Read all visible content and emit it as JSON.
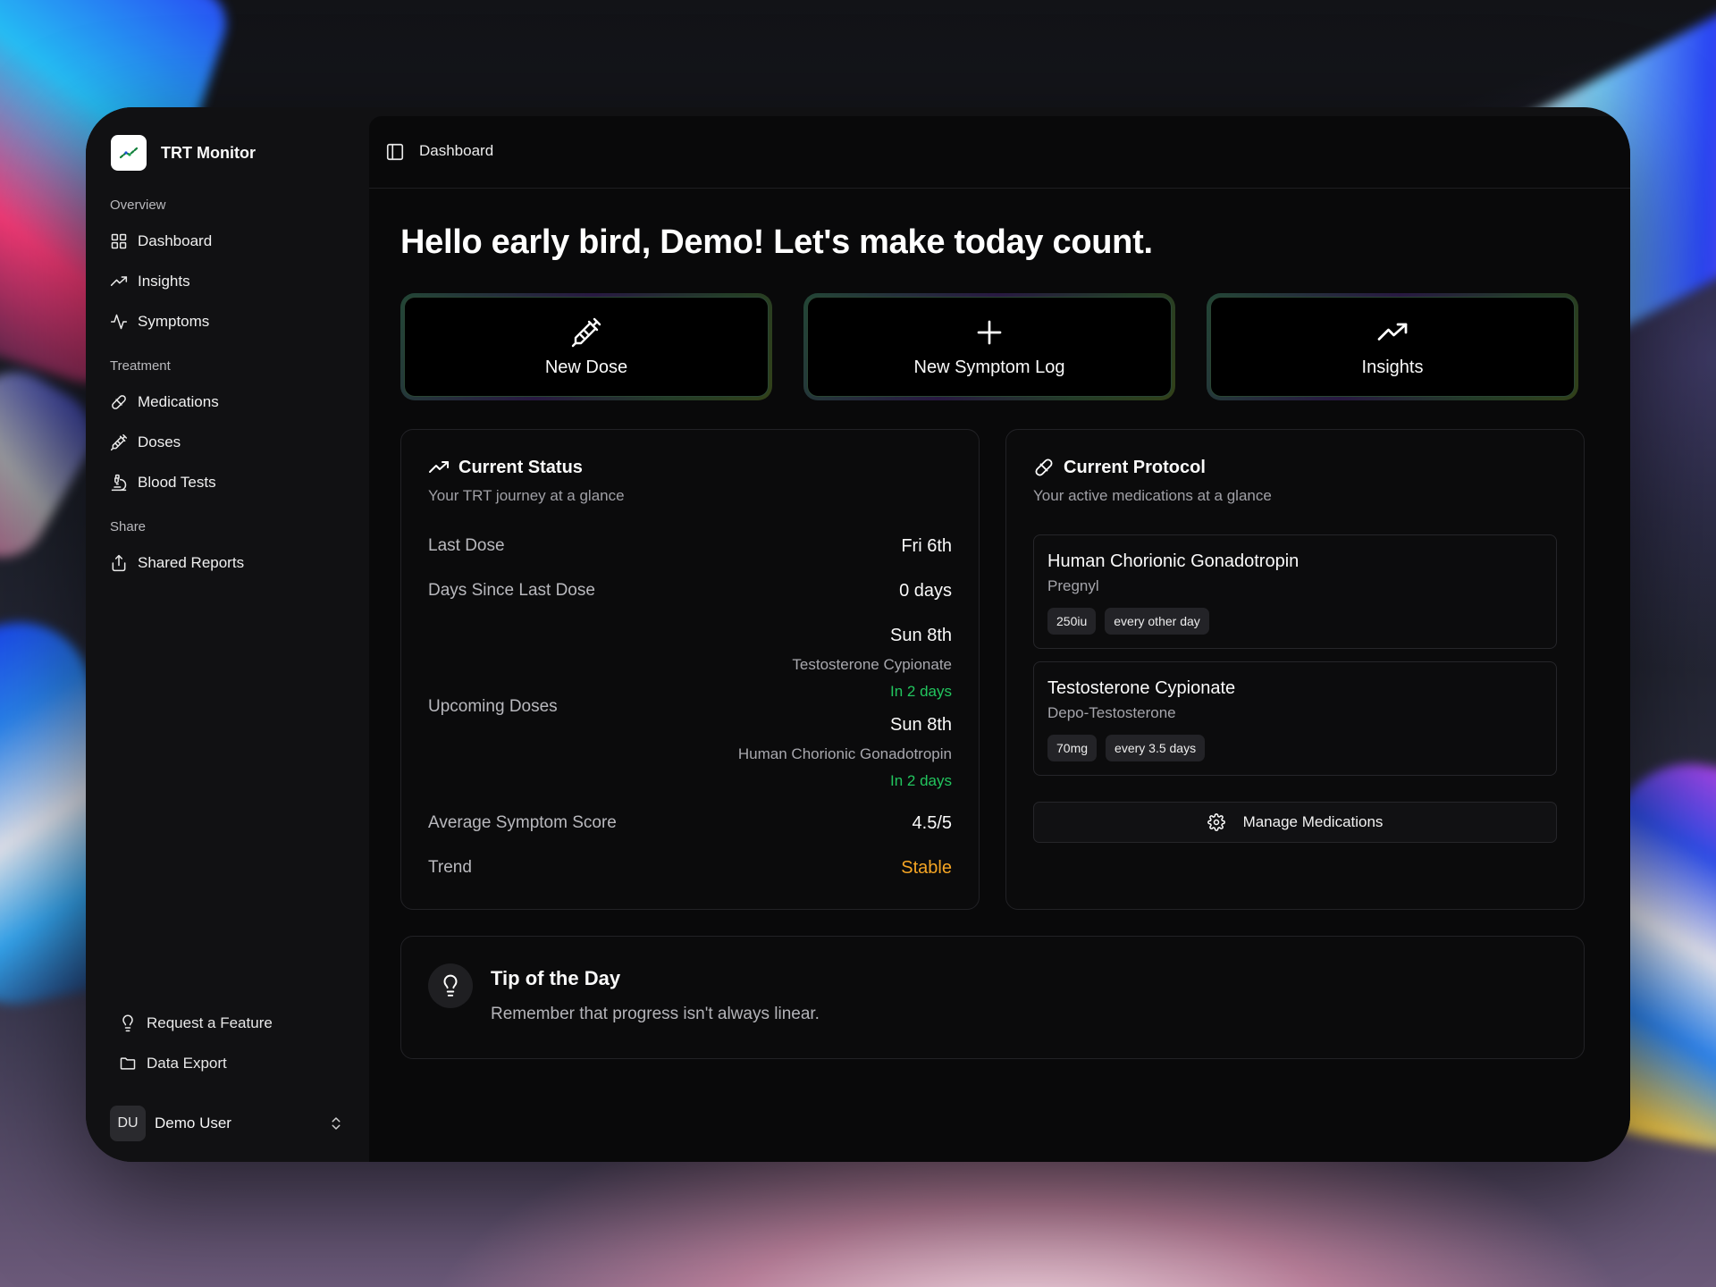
{
  "app": {
    "name": "TRT Monitor"
  },
  "sidebar": {
    "sections": [
      {
        "label": "Overview",
        "items": [
          {
            "label": "Dashboard",
            "icon": "grid-icon"
          },
          {
            "label": "Insights",
            "icon": "trending-up-icon"
          },
          {
            "label": "Symptoms",
            "icon": "activity-icon"
          }
        ]
      },
      {
        "label": "Treatment",
        "items": [
          {
            "label": "Medications",
            "icon": "pill-icon"
          },
          {
            "label": "Doses",
            "icon": "syringe-icon"
          },
          {
            "label": "Blood Tests",
            "icon": "microscope-icon"
          }
        ]
      },
      {
        "label": "Share",
        "items": [
          {
            "label": "Shared Reports",
            "icon": "share-icon"
          }
        ]
      }
    ],
    "footer": [
      {
        "label": "Request a Feature",
        "icon": "lightbulb-icon"
      },
      {
        "label": "Data Export",
        "icon": "folder-icon"
      }
    ],
    "user": {
      "initials": "DU",
      "name": "Demo User"
    }
  },
  "topbar": {
    "breadcrumb": "Dashboard"
  },
  "greeting": "Hello early bird, Demo! Let's make today count.",
  "quick_actions": [
    {
      "label": "New Dose",
      "icon": "syringe-icon"
    },
    {
      "label": "New Symptom Log",
      "icon": "plus-icon"
    },
    {
      "label": "Insights",
      "icon": "trending-up-icon"
    }
  ],
  "status": {
    "title": "Current Status",
    "subtitle": "Your TRT journey at a glance",
    "last_dose_label": "Last Dose",
    "last_dose_value": "Fri 6th",
    "days_since_label": "Days Since Last Dose",
    "days_since_value": "0 days",
    "upcoming_label": "Upcoming Doses",
    "upcoming": [
      {
        "date": "Sun 8th",
        "medication": "Testosterone Cypionate",
        "in": "In 2 days"
      },
      {
        "date": "Sun 8th",
        "medication": "Human Chorionic Gonadotropin",
        "in": "In 2 days"
      }
    ],
    "avg_score_label": "Average Symptom Score",
    "avg_score_value": "4.5/5",
    "trend_label": "Trend",
    "trend_value": "Stable"
  },
  "protocol": {
    "title": "Current Protocol",
    "subtitle": "Your active medications at a glance",
    "medications": [
      {
        "name": "Human Chorionic Gonadotropin",
        "brand": "Pregnyl",
        "dose": "250iu",
        "frequency": "every other day"
      },
      {
        "name": "Testosterone Cypionate",
        "brand": "Depo-Testosterone",
        "dose": "70mg",
        "frequency": "every 3.5 days"
      }
    ],
    "manage_label": "Manage Medications"
  },
  "tip": {
    "title": "Tip of the Day",
    "text": "Remember that progress isn't always linear."
  },
  "colors": {
    "accent_green": "#22c55e",
    "trend_amber": "#f5a524",
    "background": "#09090a"
  }
}
